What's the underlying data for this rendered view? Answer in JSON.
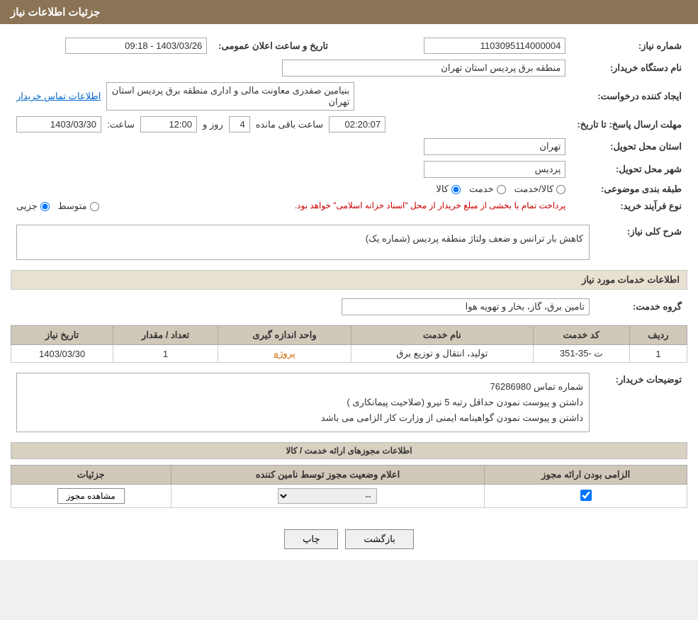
{
  "header": {
    "title": "جزئیات اطلاعات نیاز"
  },
  "fields": {
    "need_number_label": "شماره نیاز:",
    "need_number_value": "1103095114000004",
    "announcement_date_label": "تاریخ و ساعت اعلان عمومی:",
    "announcement_date_value": "1403/03/26 - 09:18",
    "buyer_org_label": "نام دستگاه خریدار:",
    "buyer_org_value": "منطقه برق پردیس استان تهران",
    "creator_label": "ایجاد کننده درخواست:",
    "creator_value": "بنیامین صفدری معاونت مالی و اداری منطقه برق پردیس استان تهران",
    "contact_link": "اطلاعات تماس خریدار",
    "deadline_label": "مهلت ارسال پاسخ: تا تاریخ:",
    "deadline_date": "1403/03/30",
    "deadline_time_label": "ساعت:",
    "deadline_time": "12:00",
    "deadline_days_label": "روز و",
    "deadline_days": "4",
    "deadline_remaining_label": "ساعت باقی مانده",
    "deadline_remaining": "02:20:07",
    "province_label": "استان محل تحویل:",
    "province_value": "تهران",
    "city_label": "شهر محل تحویل:",
    "city_value": "پردیس",
    "category_label": "طبقه بندی موضوعی:",
    "category_radio1": "کالا",
    "category_radio2": "خدمت",
    "category_radio3": "کالا/خدمت",
    "purchase_type_label": "نوع فرآیند خرید:",
    "purchase_radio1": "جزیی",
    "purchase_radio2": "متوسط",
    "purchase_warning": "پرداخت تمام یا بخشی از مبلغ خریدار از محل \"اسناد خزانه اسلامی\" خواهد بود.",
    "need_description_label": "شرح کلی نیاز:",
    "need_description_value": "کاهش بار ترانس و ضعف ولتاژ منطقه پردیس (شماره یک)",
    "services_section_title": "اطلاعات خدمات مورد نیاز",
    "service_group_label": "گروه خدمت:",
    "service_group_value": "تامین برق، گاز، بخار و تهویه هوا",
    "table": {
      "headers": [
        "ردیف",
        "کد خدمت",
        "نام خدمت",
        "واحد اندازه گیری",
        "تعداد / مقدار",
        "تاریخ نیاز"
      ],
      "rows": [
        {
          "row": "1",
          "service_code": "ت -35-351",
          "service_name": "تولید، انتقال و توزیع برق",
          "unit": "پروژه",
          "quantity": "1",
          "date": "1403/03/30"
        }
      ]
    },
    "buyer_notes_label": "توضیحات خریدار:",
    "buyer_notes_line1": "شماره تماس 76286980",
    "buyer_notes_line2": "داشتن و پیوست نمودن حداقل رتبه 5 نیرو (صلاحیت پیمانکاری )",
    "buyer_notes_line3": "داشتن و پیوست نمودن گواهینامه ایمنی از وزارت کار الزامی می باشد",
    "permissions_section_title": "اطلاعات مجوزهای ارائه خدمت / کالا",
    "permissions_table": {
      "headers": [
        "الزامی بودن ارائه مجوز",
        "اعلام وضعیت مجوز توسط نامین کننده",
        "جزئیات"
      ],
      "rows": [
        {
          "required": true,
          "status": "--",
          "details_btn": "مشاهده مجوز"
        }
      ]
    }
  },
  "buttons": {
    "back": "بازگشت",
    "print": "چاپ"
  }
}
